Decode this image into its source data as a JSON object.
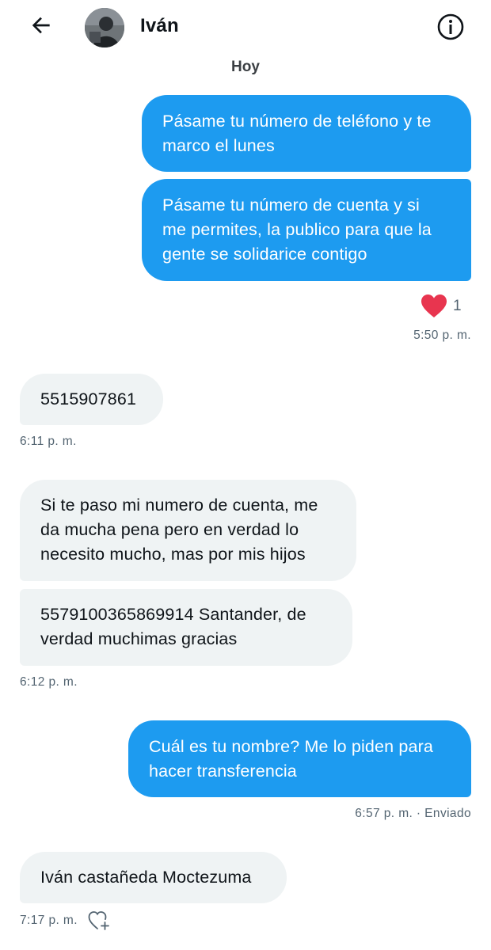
{
  "header": {
    "contact_name": "Iván",
    "back_icon": "arrow-left-icon",
    "info_icon": "info-icon"
  },
  "date_separator": "Hoy",
  "messages": [
    {
      "direction": "out",
      "text": "Pásame tu número de teléfono y te\nmarco el lunes"
    },
    {
      "direction": "out",
      "text": "Pásame tu número de cuenta y si\nme permites, la publico para que la\ngente se solidarice contigo"
    },
    {
      "direction": "in",
      "text": "5515907861"
    },
    {
      "direction": "in",
      "text": "Si te paso mi numero de cuenta, me\nda mucha pena pero en verdad lo\nnecesito mucho, mas por mis hijos"
    },
    {
      "direction": "in",
      "text": "5579100365869914 Santander, de\nverdad muchimas gracias"
    },
    {
      "direction": "out",
      "text": "Cuál es tu nombre? Me lo piden para\nhacer transferencia"
    },
    {
      "direction": "in",
      "text": "Iván castañeda Moctezuma"
    }
  ],
  "reaction": {
    "icon": "heart-icon",
    "count": "1"
  },
  "timestamps": {
    "t1": "5:50 p. m.",
    "t2": "6:11 p. m.",
    "t3": "6:12 p. m.",
    "t4": "6:57 p. m. · Enviado",
    "t5": "7:17 p. m."
  },
  "colors": {
    "outgoing_bubble": "#1d9bf0",
    "incoming_bubble": "#eff3f4",
    "reaction_heart": "#e8354f"
  }
}
